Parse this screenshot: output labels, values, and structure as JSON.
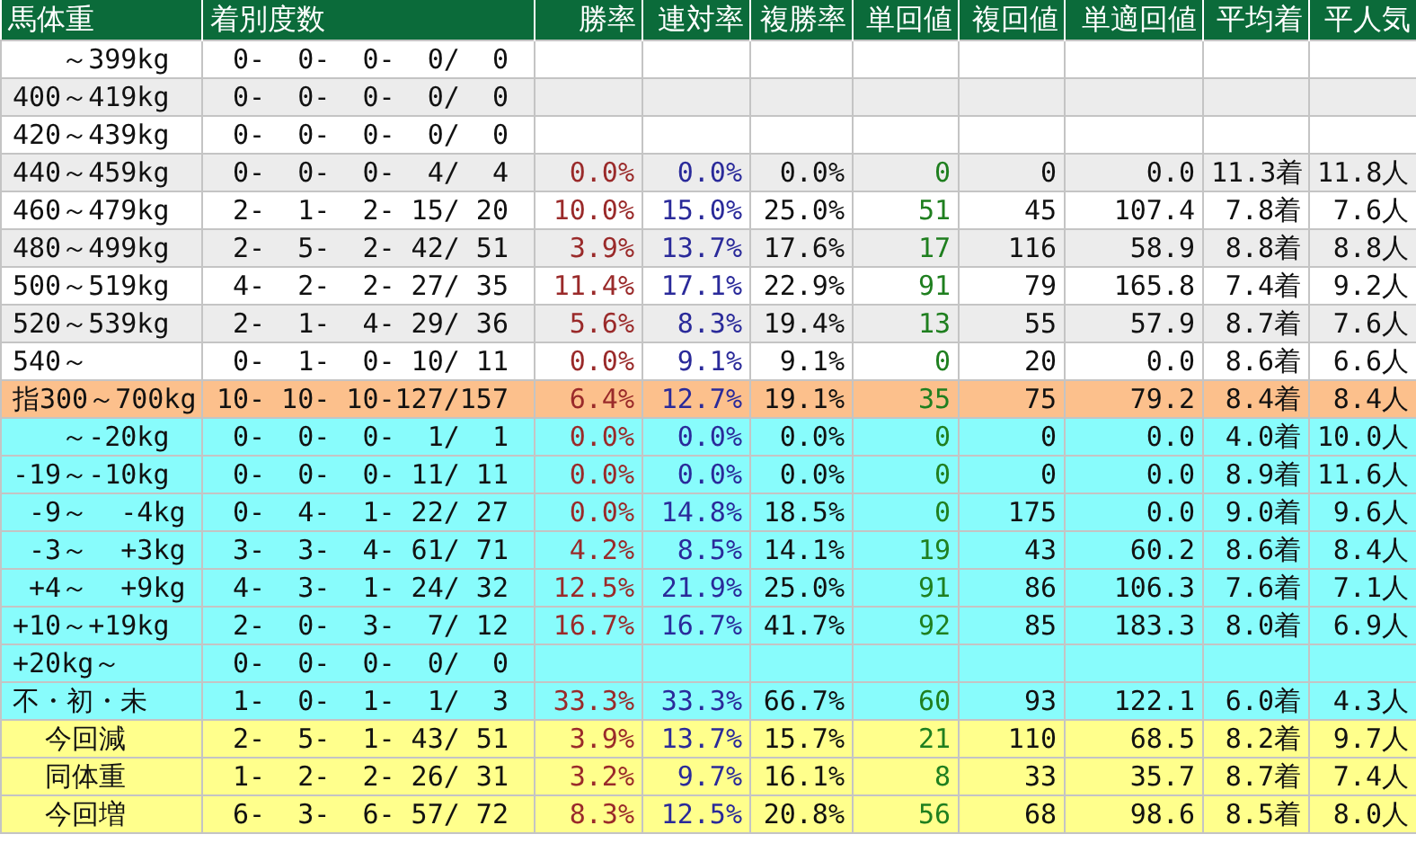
{
  "columns": [
    {
      "label": "馬体重",
      "kind": "label"
    },
    {
      "label": "着別度数",
      "kind": "record"
    },
    {
      "label": "勝率",
      "kind": "win"
    },
    {
      "label": "連対率",
      "kind": "quinella"
    },
    {
      "label": "複勝率",
      "kind": "plain"
    },
    {
      "label": "単回値",
      "kind": "return"
    },
    {
      "label": "複回値",
      "kind": "plain"
    },
    {
      "label": "単適回値",
      "kind": "plain"
    },
    {
      "label": "平均着",
      "kind": "plain"
    },
    {
      "label": "平人気",
      "kind": "plain"
    }
  ],
  "rows": [
    {
      "kind": "weight",
      "label": "   ～399kg",
      "record": "0-  0-  0-  0/  0"
    },
    {
      "kind": "weight",
      "label": "400～419kg",
      "record": "0-  0-  0-  0/  0"
    },
    {
      "kind": "weight",
      "label": "420～439kg",
      "record": "0-  0-  0-  0/  0"
    },
    {
      "kind": "weight",
      "label": "440～459kg",
      "record": "0-  0-  0-  4/  4",
      "stats": [
        "0.0%",
        "0.0%",
        "0.0%",
        "0",
        "0",
        "0.0",
        "11.3着",
        "11.8人"
      ]
    },
    {
      "kind": "weight",
      "label": "460～479kg",
      "record": "2-  1-  2- 15/ 20",
      "stats": [
        "10.0%",
        "15.0%",
        "25.0%",
        "51",
        "45",
        "107.4",
        "7.8着",
        "7.6人"
      ]
    },
    {
      "kind": "weight",
      "label": "480～499kg",
      "record": "2-  5-  2- 42/ 51",
      "stats": [
        "3.9%",
        "13.7%",
        "17.6%",
        "17",
        "116",
        "58.9",
        "8.8着",
        "8.8人"
      ]
    },
    {
      "kind": "weight",
      "label": "500～519kg",
      "record": "4-  2-  2- 27/ 35",
      "stats": [
        "11.4%",
        "17.1%",
        "22.9%",
        "91",
        "79",
        "165.8",
        "7.4着",
        "9.2人"
      ]
    },
    {
      "kind": "weight",
      "label": "520～539kg",
      "record": "2-  1-  4- 29/ 36",
      "stats": [
        "5.6%",
        "8.3%",
        "19.4%",
        "13",
        "55",
        "57.9",
        "8.7着",
        "7.6人"
      ]
    },
    {
      "kind": "weight",
      "label": "540～",
      "record": "0-  1-  0- 10/ 11",
      "stats": [
        "0.0%",
        "9.1%",
        "9.1%",
        "0",
        "20",
        "0.0",
        "8.6着",
        "6.6人"
      ]
    },
    {
      "kind": "total",
      "label": "指300～700kg",
      "record": "10- 10- 10-127/157",
      "stats": [
        "6.4%",
        "12.7%",
        "19.1%",
        "35",
        "75",
        "79.2",
        "8.4着",
        "8.4人"
      ]
    },
    {
      "kind": "change",
      "label": "   ～-20kg",
      "record": "0-  0-  0-  1/  1",
      "stats": [
        "0.0%",
        "0.0%",
        "0.0%",
        "0",
        "0",
        "0.0",
        "4.0着",
        "10.0人"
      ]
    },
    {
      "kind": "change",
      "label": "-19～-10kg",
      "record": "0-  0-  0- 11/ 11",
      "stats": [
        "0.0%",
        "0.0%",
        "0.0%",
        "0",
        "0",
        "0.0",
        "8.9着",
        "11.6人"
      ]
    },
    {
      "kind": "change",
      "label": " -9～  -4kg",
      "record": "0-  4-  1- 22/ 27",
      "stats": [
        "0.0%",
        "14.8%",
        "18.5%",
        "0",
        "175",
        "0.0",
        "9.0着",
        "9.6人"
      ]
    },
    {
      "kind": "change",
      "label": " -3～  +3kg",
      "record": "3-  3-  4- 61/ 71",
      "stats": [
        "4.2%",
        "8.5%",
        "14.1%",
        "19",
        "43",
        "60.2",
        "8.6着",
        "8.4人"
      ]
    },
    {
      "kind": "change",
      "label": " +4～  +9kg",
      "record": "4-  3-  1- 24/ 32",
      "stats": [
        "12.5%",
        "21.9%",
        "25.0%",
        "91",
        "86",
        "106.3",
        "7.6着",
        "7.1人"
      ]
    },
    {
      "kind": "change",
      "label": "+10～+19kg",
      "record": "2-  0-  3-  7/ 12",
      "stats": [
        "16.7%",
        "16.7%",
        "41.7%",
        "92",
        "85",
        "183.3",
        "8.0着",
        "6.9人"
      ]
    },
    {
      "kind": "change",
      "label": "+20kg～",
      "record": "0-  0-  0-  0/  0"
    },
    {
      "kind": "change",
      "label": "不・初・未",
      "record": "1-  0-  1-  1/  3",
      "stats": [
        "33.3%",
        "33.3%",
        "66.7%",
        "60",
        "93",
        "122.1",
        "6.0着",
        "4.3人"
      ]
    },
    {
      "kind": "compare",
      "label": "  今回減",
      "record": "2-  5-  1- 43/ 51",
      "stats": [
        "3.9%",
        "13.7%",
        "15.7%",
        "21",
        "110",
        "68.5",
        "8.2着",
        "9.7人"
      ]
    },
    {
      "kind": "compare",
      "label": "  同体重",
      "record": "1-  2-  2- 26/ 31",
      "stats": [
        "3.2%",
        "9.7%",
        "16.1%",
        "8",
        "33",
        "35.7",
        "8.7着",
        "7.4人"
      ]
    },
    {
      "kind": "compare",
      "label": "  今回増",
      "record": "6-  3-  6- 57/ 72",
      "stats": [
        "8.3%",
        "12.5%",
        "20.8%",
        "56",
        "68",
        "98.6",
        "8.5着",
        "8.0人"
      ]
    }
  ]
}
